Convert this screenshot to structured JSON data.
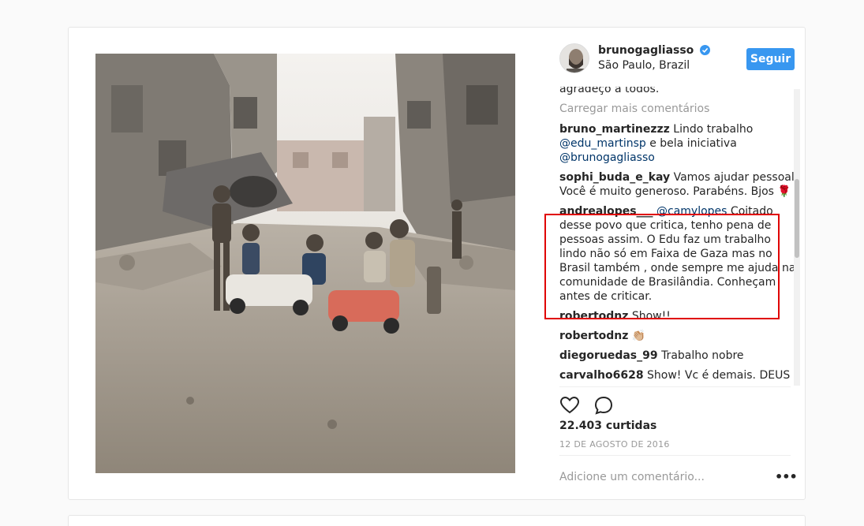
{
  "post": {
    "username": "brunogagliasso",
    "location": "São Paulo, Brazil",
    "follow_label": "Seguir",
    "likes_text": "22.403 curtidas",
    "date_text": "12 DE AGOSTO DE 2016",
    "add_comment_placeholder": "Adicione um comentário...",
    "more_label": "•••",
    "load_more": "Carregar mais comentários",
    "truncated_caption_end": "agradeço a todos.",
    "accent_color": "#3897f0",
    "highlight_color": "#e00000"
  },
  "comments": [
    {
      "user": "bruno_martinezzz",
      "parts": [
        "Lindo trabalho ",
        "@edu_martinsp",
        " e bela iniciativa ",
        "@brunogagliasso"
      ]
    },
    {
      "user": "sophi_buda_e_kay",
      "text": "Vamos ajudar pessoal. Você é muito generoso. Parabéns. Bjos 🌹"
    },
    {
      "user": "andrealopes___",
      "mention": "@camylopes",
      "text": " Coitado desse povo que critica, tenho pena de pessoas assim. O Edu faz um trabalho lindo não só em Faixa de Gaza mas no Brasil também , onde sempre me ajuda na comunidade de Brasilândia. Conheçam antes de criticar."
    },
    {
      "user": "robertodnz",
      "text": "Show!!"
    },
    {
      "user": "robertodnz",
      "text": "👏🏼"
    },
    {
      "user": "diegoruedas_99",
      "text": "Trabalho nobre"
    },
    {
      "user": "carvalho6628",
      "text": "Show! Vc é demais. DEUS"
    }
  ],
  "icons": {
    "heart": "heart-icon",
    "comment": "comment-icon",
    "verified": "verified-badge-icon",
    "more": "more-options-icon"
  }
}
